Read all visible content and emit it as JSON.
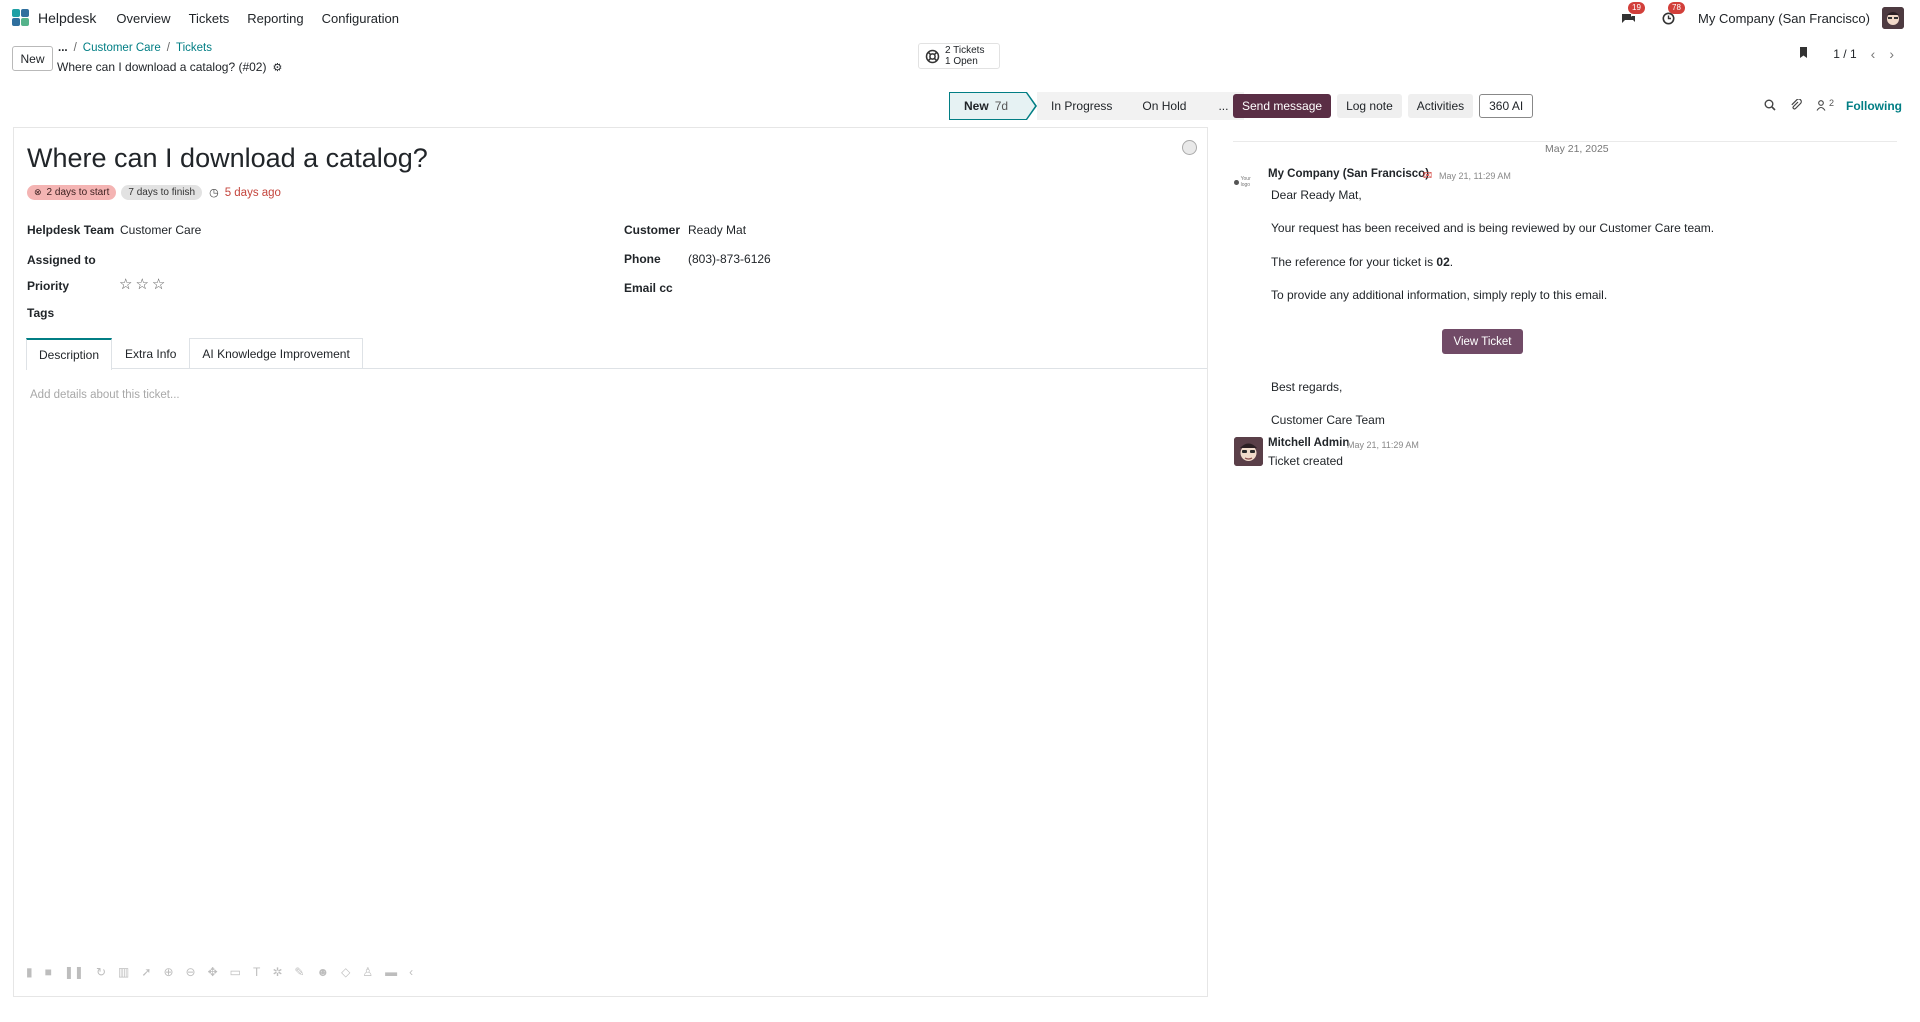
{
  "app": {
    "title": "Helpdesk"
  },
  "nav": {
    "items": [
      "Overview",
      "Tickets",
      "Reporting",
      "Configuration"
    ]
  },
  "systray": {
    "messages_badge": "19",
    "activities_badge": "78",
    "company": "My Company (San Francisco)"
  },
  "control": {
    "new_label": "New",
    "breadcrumb_more": "...",
    "breadcrumbs": [
      "Customer Care",
      "Tickets"
    ],
    "record_title": "Where can I download a catalog? (#02)",
    "ticket_stat_line1": "2 Tickets",
    "ticket_stat_line2": "1 Open",
    "pager": "1 / 1"
  },
  "statusbar": {
    "current_stage": "New",
    "current_days": "7d",
    "stages": [
      "In Progress",
      "On Hold"
    ],
    "more": "..."
  },
  "ticket": {
    "title": "Where can I download a catalog?",
    "chip_start": "2 days to start",
    "chip_finish": "7 days to finish",
    "ago": "5 days ago",
    "labels": {
      "team": "Helpdesk Team",
      "assigned": "Assigned to",
      "priority": "Priority",
      "tags": "Tags",
      "customer": "Customer",
      "phone": "Phone",
      "email_cc": "Email cc"
    },
    "values": {
      "team": "Customer Care",
      "customer": "Ready Mat",
      "phone": "(803)-873-6126"
    },
    "priority_stars": 0,
    "tabs": [
      "Description",
      "Extra Info",
      "AI Knowledge Improvement"
    ],
    "description_placeholder": "Add details about this ticket..."
  },
  "chatter": {
    "buttons": {
      "send": "Send message",
      "log": "Log note",
      "activities": "Activities",
      "ai": "360 AI"
    },
    "followers_count": "2",
    "following": "Following",
    "date_separator": "May 21, 2025",
    "message1": {
      "author": "My Company (San Francisco)",
      "date": "May 21, 11:29 AM",
      "logo_text": "Your logo",
      "greeting": "Dear Ready Mat,",
      "line1": "Your request has been received and is being reviewed by our Customer Care team.",
      "line2_pre": "The reference for your ticket is ",
      "line2_ref": "02",
      "line2_post": ".",
      "line3": "To provide any additional information, simply reply to this email.",
      "button": "View Ticket",
      "regards": "Best regards,",
      "signature": "Customer Care Team"
    },
    "message2": {
      "author": "Mitchell Admin",
      "date": "May 21, 11:29 AM",
      "body": "Ticket created"
    }
  }
}
